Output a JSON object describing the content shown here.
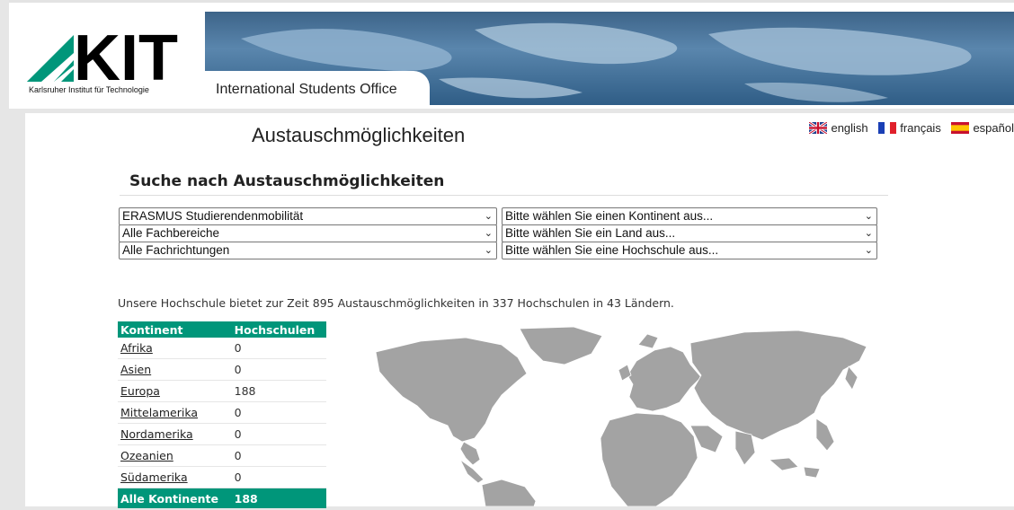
{
  "header": {
    "logo_text": "KIT",
    "logo_subtitle": "Karlsruher Institut für Technologie",
    "banner_title": "International Students Office"
  },
  "languages": [
    {
      "label": "english",
      "icon": "uk-flag-icon"
    },
    {
      "label": "français",
      "icon": "france-flag-icon"
    },
    {
      "label": "español",
      "icon": "spain-flag-icon"
    }
  ],
  "page": {
    "title": "Austauschmöglichkeiten",
    "search_heading": "Suche nach Austauschmöglichkeiten"
  },
  "filters": {
    "program": "ERASMUS Studierendenmobilität",
    "department": "Alle Fachbereiche",
    "field": "Alle Fachrichtungen",
    "continent": "Bitte wählen Sie einen Kontinent aus...",
    "country": "Bitte wählen Sie ein Land aus...",
    "university": "Bitte wählen Sie eine Hochschule aus..."
  },
  "info_text": "Unsere Hochschule bietet zur Zeit 895 Austauschmöglichkeiten in 337 Hochschulen in 43 Ländern.",
  "table": {
    "headers": [
      "Kontinent",
      "Hochschulen"
    ],
    "rows": [
      {
        "name": "Afrika",
        "count": "0"
      },
      {
        "name": "Asien",
        "count": "0"
      },
      {
        "name": "Europa",
        "count": "188"
      },
      {
        "name": "Mittelamerika",
        "count": "0"
      },
      {
        "name": "Nordamerika",
        "count": "0"
      },
      {
        "name": "Ozeanien",
        "count": "0"
      },
      {
        "name": "Südamerika",
        "count": "0"
      }
    ],
    "total": {
      "name": "Alle Kontinente",
      "count": "188"
    }
  },
  "colors": {
    "accent": "#00967a",
    "map_land": "#a3a3a3"
  }
}
